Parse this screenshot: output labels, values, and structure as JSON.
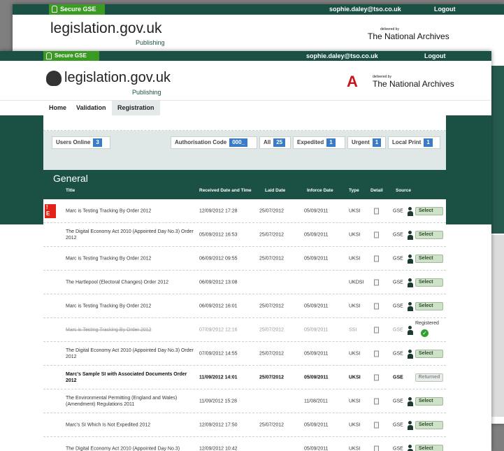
{
  "back_window": {
    "secure": "Secure GSE",
    "email": "sophie.daley@tso.co.uk",
    "logout": "Logout",
    "brand": "legislation.gov.uk",
    "brand_sub": "Publishing",
    "tna_small": "delivered by",
    "tna": "The National Archives"
  },
  "front": {
    "secure": "Secure GSE",
    "email": "sophie.daley@tso.co.uk",
    "logout": "Logout",
    "brand": "legislation.gov.uk",
    "brand_sub": "Publishing",
    "tna_small": "delivered by",
    "tna": "The National Archives",
    "nav": [
      "Home",
      "Validation",
      "Registration"
    ]
  },
  "filters": {
    "users_online": {
      "label": "Users Online",
      "count": "3"
    },
    "auth_code": {
      "label": "Authorisation Code",
      "value": "000_"
    },
    "all": {
      "label": "All",
      "count": "25"
    },
    "expedited": {
      "label": "Expedited",
      "count": "1"
    },
    "urgent": {
      "label": "Urgent",
      "count": "1"
    },
    "local_print": {
      "label": "Local Print",
      "count": "1"
    }
  },
  "table": {
    "section_title": "General",
    "columns": [
      "Title",
      "Received Date and Time",
      "Laid Date",
      "Inforce Date",
      "Type",
      "Detail",
      "Source"
    ],
    "rows": [
      {
        "title": "Marc is Testing Tracking By Order 2012",
        "received": "12/09/2012 17:28",
        "laid": "25/07/2012",
        "inforce": "05/09/2011",
        "type": "UKSI",
        "source": "GSE",
        "action": "Select"
      },
      {
        "title": "The Digital Economy Act 2010 (Appointed Day No.3) Order 2012",
        "received": "05/09/2012 16:53",
        "laid": "25/07/2012",
        "inforce": "05/09/2011",
        "type": "UKSI",
        "source": "GSE",
        "action": "Select"
      },
      {
        "title": "Marc is Testing Tracking By Order 2012",
        "received": "06/09/2012 09:55",
        "laid": "25/07/2012",
        "inforce": "05/09/2011",
        "type": "UKSI",
        "source": "GSE",
        "action": "Select"
      },
      {
        "title": "The Hartlepool (Electoral Changes) Order 2012",
        "received": "06/09/2012 13:08",
        "laid": "",
        "inforce": "",
        "type": "UKDSI",
        "source": "GSE",
        "action": "Select"
      },
      {
        "title": "Marc is Testing Tracking By Order 2012",
        "received": "06/09/2012 16:01",
        "laid": "25/07/2012",
        "inforce": "05/09/2011",
        "type": "UKSI",
        "source": "GSE",
        "action": "Select"
      },
      {
        "title": "Marc is Testing Tracking By Order 2012",
        "received": "07/09/2012 12:16",
        "laid": "25/07/2012",
        "inforce": "05/09/2011",
        "type": "SSI",
        "source": "GSE",
        "action": "Registered"
      },
      {
        "title": "The Digital Economy Act 2010 (Appointed Day No.3) Order 2012",
        "received": "07/09/2012 14:55",
        "laid": "25/07/2012",
        "inforce": "05/09/2011",
        "type": "UKSI",
        "source": "GSE",
        "action": "Select"
      },
      {
        "title": "Marc's Sample SI with Associated Documents Order 2012",
        "received": "11/09/2012 14:01",
        "laid": "25/07/2012",
        "inforce": "05/09/2011",
        "type": "UKSI",
        "source": "GSE",
        "action": "Returned"
      },
      {
        "title": "The Environmental Permitting (England and Wales) (Amendment) Regulations 2011",
        "received": "11/09/2012 15:28",
        "laid": "",
        "inforce": "11/08/2011",
        "type": "UKSI",
        "source": "GSE",
        "action": "Select"
      },
      {
        "title": "Marc's SI Which Is Not Expedited 2012",
        "received": "12/09/2012 17:50",
        "laid": "25/07/2012",
        "inforce": "05/09/2011",
        "type": "UKSI",
        "source": "GSE",
        "action": "Select"
      },
      {
        "title": "The Digital Economy Act 2010 (Appointed Day No.3)",
        "received": "12/09/2012 10:42",
        "laid": "",
        "inforce": "05/09/2011",
        "type": "UKSI",
        "source": "GSE",
        "action": "Select"
      }
    ]
  },
  "flag": {
    "line1": "!",
    "line2": "E"
  },
  "colors": {
    "teal": "#1b5045",
    "secure_green": "#3a9a23",
    "badge_blue": "#3a7bc8",
    "select_green": "#cfe2c9",
    "flag_red": "#e2231a"
  }
}
